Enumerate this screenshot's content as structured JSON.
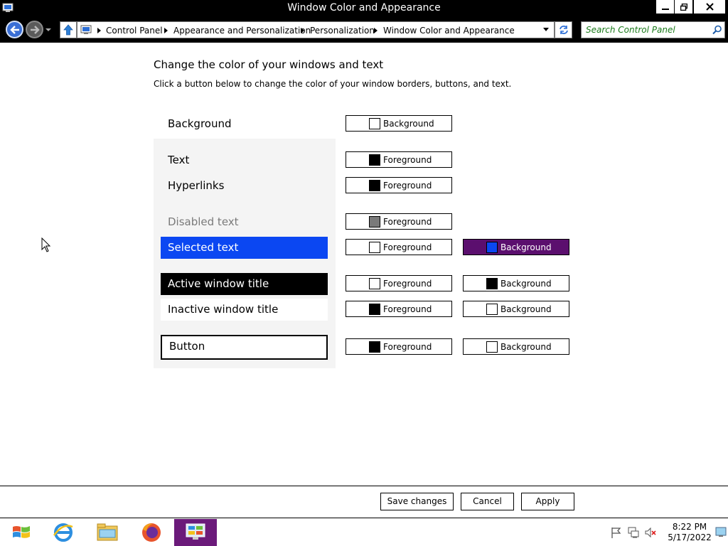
{
  "window": {
    "title": "Window Color and Appearance",
    "min_label": "minimize",
    "max_label": "restore",
    "close_label": "close"
  },
  "nav": {
    "breadcrumbs": [
      "Control Panel",
      "Appearance and Personalization",
      "Personalization",
      "Window Color and Appearance"
    ],
    "search_placeholder": "Search Control Panel"
  },
  "page": {
    "heading": "Change the color of your windows and text",
    "subheading": "Click a button below to change the color of your window borders, buttons, and text."
  },
  "items": [
    {
      "label": "Background",
      "fg": null,
      "bg": {
        "label": "Background",
        "swatch": "#ffffff"
      }
    },
    {
      "label": "Text",
      "fg": {
        "label": "Foreground",
        "swatch": "#000000"
      }
    },
    {
      "label": "Hyperlinks",
      "fg": {
        "label": "Foreground",
        "swatch": "#000000"
      }
    },
    {
      "label": "Disabled text",
      "fg": {
        "label": "Foreground",
        "swatch": "#7a7a7a"
      }
    },
    {
      "label": "Selected text",
      "fg": {
        "label": "Foreground",
        "swatch": "#ffffff"
      },
      "bg": {
        "label": "Background",
        "swatch": "#0b47f2"
      }
    },
    {
      "label": "Active window title",
      "fg": {
        "label": "Foreground",
        "swatch": "#ffffff"
      },
      "bg": {
        "label": "Background",
        "swatch": "#000000"
      }
    },
    {
      "label": "Inactive window title",
      "fg": {
        "label": "Foreground",
        "swatch": "#000000"
      },
      "bg": {
        "label": "Background",
        "swatch": "#ffffff"
      }
    },
    {
      "label": "Button",
      "fg": {
        "label": "Foreground",
        "swatch": "#000000"
      },
      "bg": {
        "label": "Background",
        "swatch": "#ffffff"
      }
    }
  ],
  "actions": {
    "save": "Save changes",
    "cancel": "Cancel",
    "apply": "Apply"
  },
  "taskbar": {
    "apps": [
      "start",
      "internet-explorer",
      "file-explorer",
      "firefox",
      "control-panel"
    ],
    "time": "8:22 PM",
    "date": "5/17/2022"
  },
  "colors": {
    "selected_bg": "#0b47f2",
    "selected_button_bg": "#5b0f6e",
    "active_taskbar": "#6b1a7a",
    "search_text": "#1a7a1a"
  }
}
